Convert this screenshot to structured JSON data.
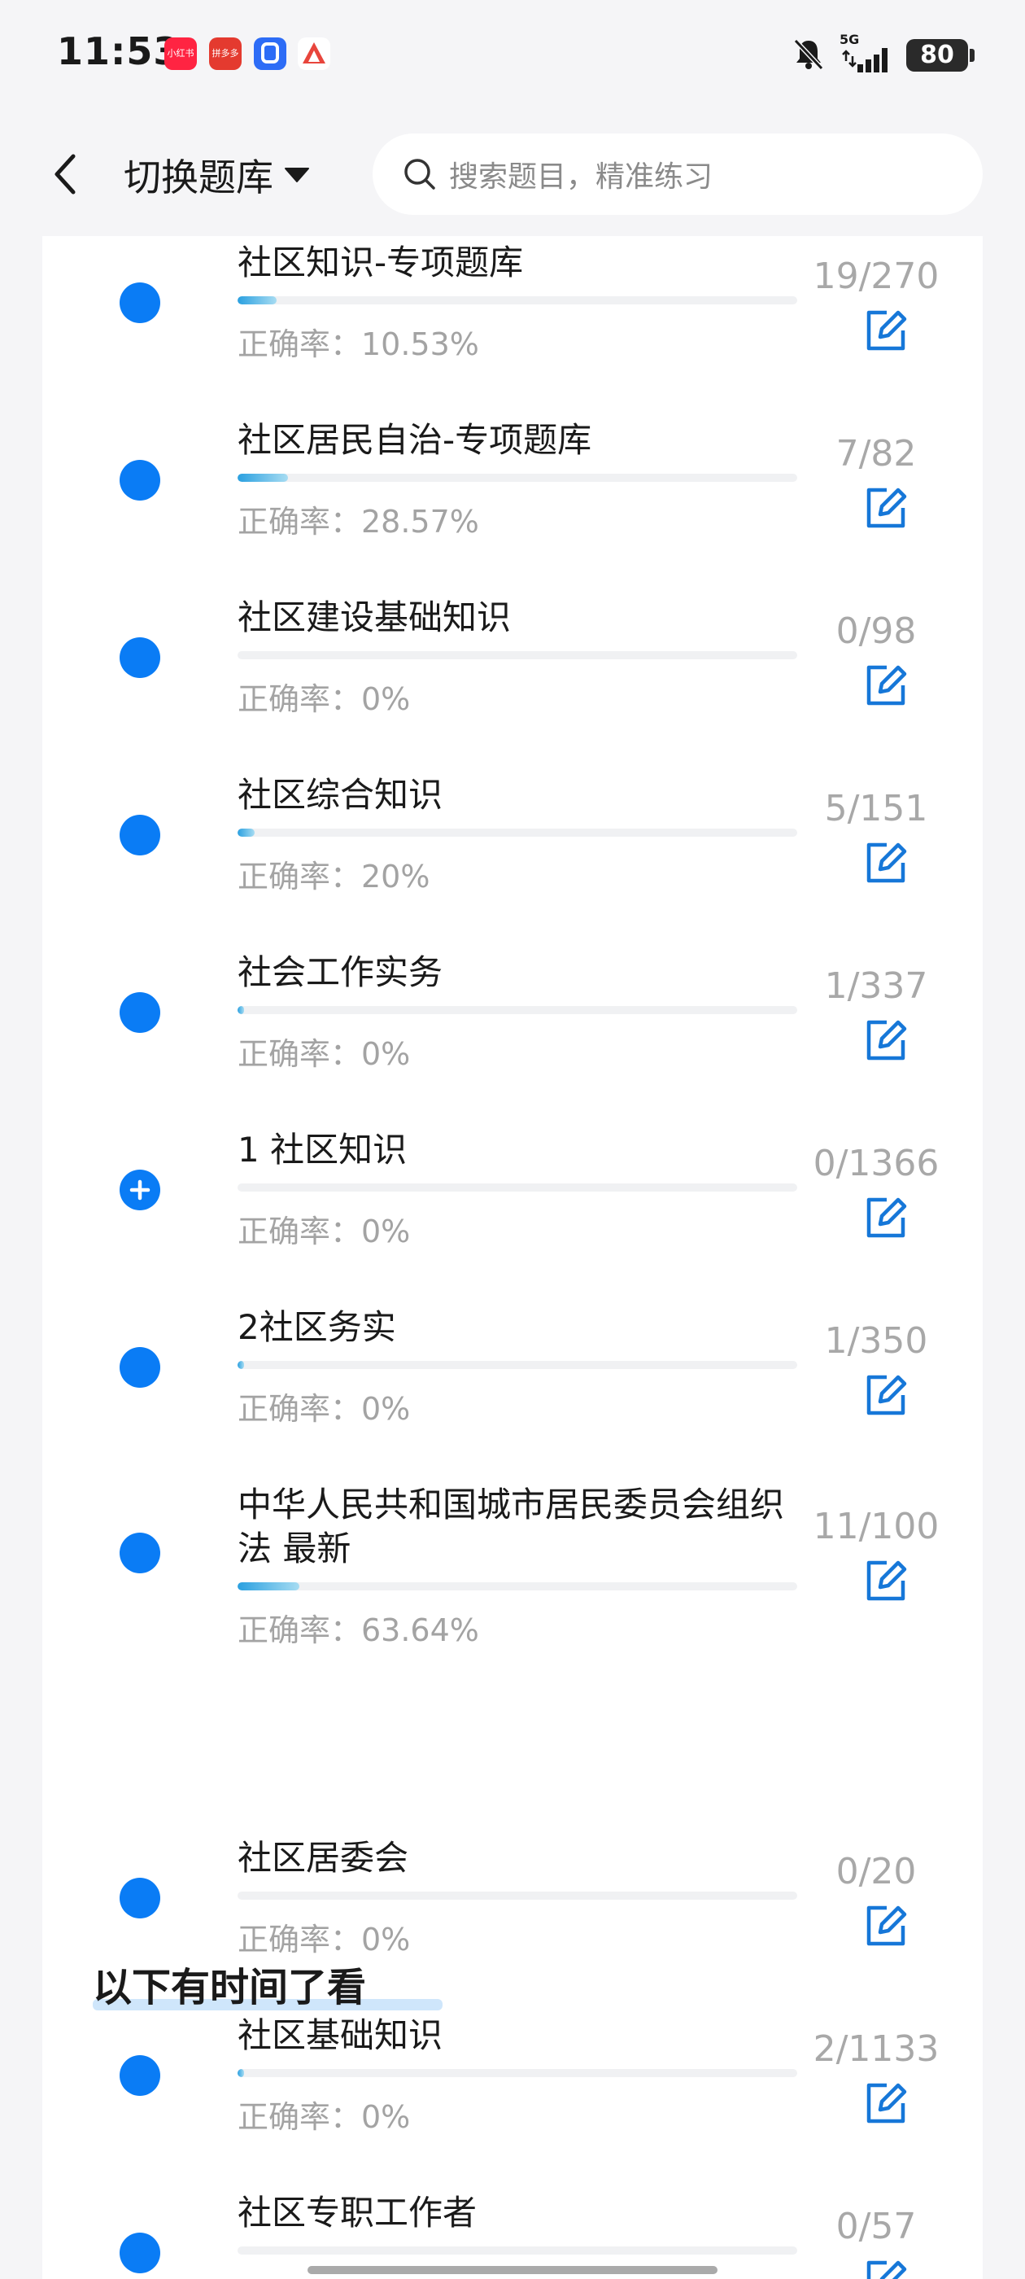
{
  "status_bar": {
    "time": "11:53",
    "app_icons": [
      "小红书",
      "拼多多",
      "",
      ""
    ],
    "network": "5G",
    "battery": "80"
  },
  "header": {
    "bank_switch_label": "切换题库",
    "search_placeholder": "搜索题目，精准练习"
  },
  "accent_color": "#0a7cf5",
  "items_main": [
    {
      "title": "社区知识-专项题库",
      "accuracy": "正确率：10.53%",
      "count": "19/270",
      "progress": 0.07,
      "bullet": "dot"
    },
    {
      "title": "社区居民自治-专项题库",
      "accuracy": "正确率：28.57%",
      "count": "7/82",
      "progress": 0.09,
      "bullet": "dot"
    },
    {
      "title": "社区建设基础知识",
      "accuracy": "正确率：0%",
      "count": "0/98",
      "progress": 0,
      "bullet": "dot"
    },
    {
      "title": "社区综合知识",
      "accuracy": "正确率：20%",
      "count": "5/151",
      "progress": 0.03,
      "bullet": "dot"
    },
    {
      "title": "社会工作实务",
      "accuracy": "正确率：0%",
      "count": "1/337",
      "progress": 0.003,
      "bullet": "dot"
    },
    {
      "title": "1 社区知识",
      "accuracy": "正确率：0%",
      "count": "0/1366",
      "progress": 0,
      "bullet": "plus"
    },
    {
      "title": "2社区务实",
      "accuracy": "正确率：0%",
      "count": "1/350",
      "progress": 0.003,
      "bullet": "dot"
    },
    {
      "title": "中华人民共和国城市居民委员会组织法 最新",
      "accuracy": "正确率：63.64%",
      "count": "11/100",
      "progress": 0.11,
      "bullet": "dot"
    }
  ],
  "section_heading": "以下有时间了看",
  "items_later": [
    {
      "title": "社区居委会",
      "accuracy": "正确率：0%",
      "count": "0/20",
      "progress": 0,
      "bullet": "dot"
    },
    {
      "title": "社区基础知识",
      "accuracy": "正确率：0%",
      "count": "2/1133",
      "progress": 0.002,
      "bullet": "dot"
    },
    {
      "title": "社区专职工作者",
      "accuracy": "",
      "count": "0/57",
      "progress": 0,
      "bullet": "dot"
    }
  ]
}
